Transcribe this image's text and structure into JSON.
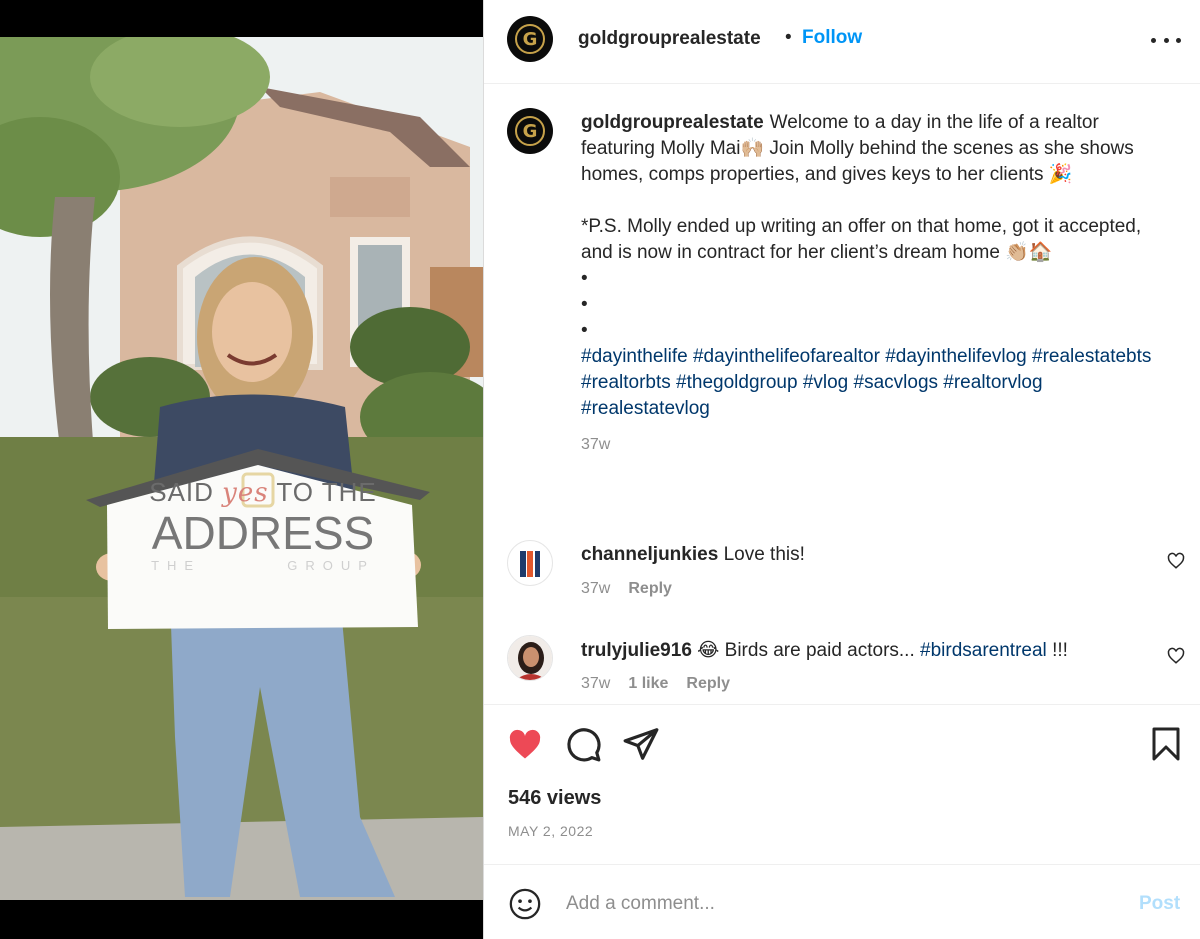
{
  "media": {
    "sign": {
      "line1_a": "SAID",
      "line1_b": "yes",
      "line1_c": "TO THE",
      "line2": "ADDRESS",
      "line3_a": "THE",
      "line3_b": "GROUP"
    }
  },
  "post": {
    "author": "goldgrouprealestate",
    "follow_label": "Follow",
    "caption": {
      "p1": "Welcome to a day in the life of a realtor featuring Molly Mai🙌🏼 Join Molly behind the scenes as she shows homes, comps properties, and gives keys to her clients 🎉",
      "p2": "*P.S. Molly ended up writing an offer on that home, got it accepted, and is now in contract for her client’s dream home 👏🏼🏠",
      "bullet1": "•",
      "bullet2": "•",
      "bullet3": "•",
      "hashtags": "#dayinthelife #dayinthelifeofarealtor #dayinthelifevlog #realestatebts #realtorbts #thegoldgroup #vlog #sacvlogs #realtorvlog #realestatevlog",
      "time": "37w"
    }
  },
  "comments": [
    {
      "user": "channeljunkies",
      "text": "Love this!",
      "time": "37w",
      "reply": "Reply"
    },
    {
      "user": "trulyjulie916",
      "text_before": "😂 Birds are paid actors...",
      "tag": "#birdsarentreal",
      "text_after": "!!!",
      "time": "37w",
      "likes": "1 like",
      "reply": "Reply"
    }
  ],
  "stats": {
    "views": "546 views",
    "date": "MAY 2, 2022"
  },
  "add_comment": {
    "placeholder": "Add a comment...",
    "post_label": "Post"
  },
  "colors": {
    "like_red": "#ed4956",
    "follow_blue": "#0095f6",
    "hashtag_blue": "#00376b",
    "muted_gray": "#8e8e8e",
    "brand_gold": "#c7a24a"
  },
  "icons": {
    "like": "heart-filled-icon",
    "comment": "comment-bubble-icon",
    "share": "paper-plane-icon",
    "save": "bookmark-icon",
    "more": "ellipsis-icon",
    "emoji": "smiley-icon",
    "comment_like": "heart-outline-icon"
  }
}
